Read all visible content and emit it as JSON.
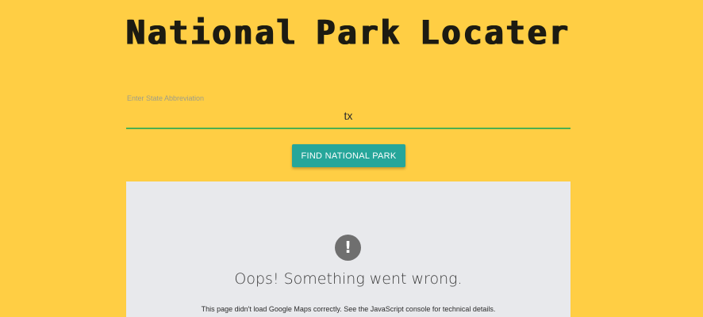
{
  "header": {
    "title_words": [
      "National",
      "Park",
      "Locater"
    ]
  },
  "search": {
    "label": "Enter State Abbreviation",
    "value": "tx"
  },
  "actions": {
    "find_label": "FIND NATIONAL PARK"
  },
  "map_error": {
    "icon": "!",
    "title": "Oops! Something went wrong.",
    "detail": "This page didn't load Google Maps correctly. See the JavaScript console for technical details."
  },
  "colors": {
    "background": "#FFCE44",
    "button": "#26a69a",
    "input_underline": "#4caf50",
    "map_panel": "#e8e9ec"
  }
}
